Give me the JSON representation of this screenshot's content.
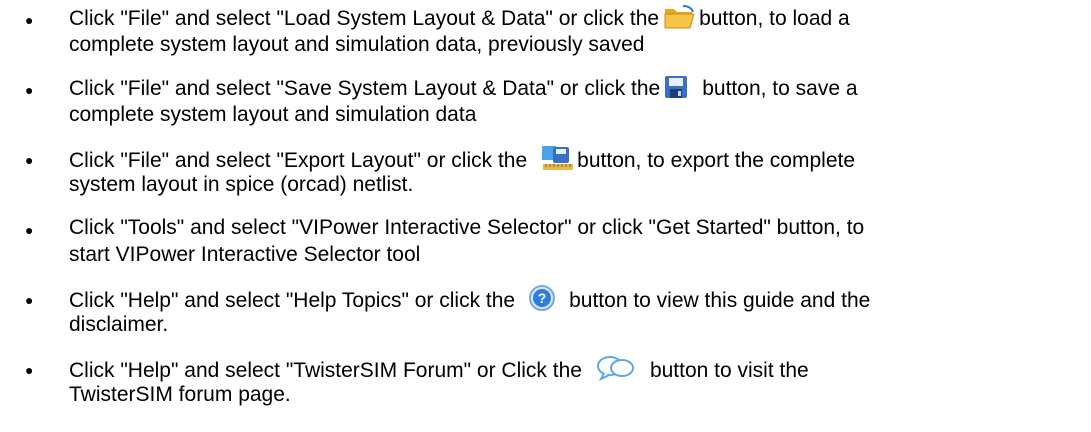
{
  "items": [
    {
      "a": "Click \"File\" and select \"Load System Layout & Data\" or click the",
      "b": "button, to load a",
      "c": "complete system layout and simulation data, previously saved",
      "icon": "open-folder-icon"
    },
    {
      "a": "Click \"File\" and select \"Save System Layout & Data\" or click the",
      "b": "button, to save a",
      "c": "complete system layout and simulation data",
      "icon": "save-floppy-icon"
    },
    {
      "a": "Click \"File\" and select \"Export Layout\" or click the",
      "b": "button, to export the complete",
      "c": "system layout in spice (orcad) netlist.",
      "icon": "export-layout-icon"
    },
    {
      "a": "Click \"Tools\" and select \"VIPower Interactive Selector\" or click \"Get Started\" button, to",
      "c": "start VIPower Interactive Selector tool"
    },
    {
      "a": "Click \"Help\" and select \"Help Topics\" or click the",
      "b": "button to view this guide and the",
      "c": "disclaimer.",
      "icon": "help-question-icon"
    },
    {
      "a": "Click \"Help\" and select \"TwisterSIM Forum\" or Click the",
      "b": "button to visit the",
      "c": "TwisterSIM forum page.",
      "icon": "forum-chat-icon"
    }
  ],
  "colors": {
    "text": "#000000",
    "folder": "#f2b233",
    "floppy": "#3a6fc7",
    "help": "#2f7be0",
    "chat": "#5aa8e8"
  }
}
